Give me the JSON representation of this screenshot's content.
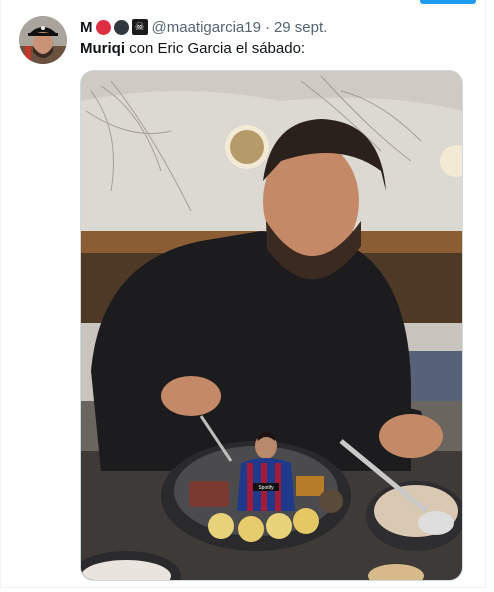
{
  "tweet": {
    "display_name": "M",
    "name_emojis": [
      "red-circle",
      "black-circle",
      "skull-and-crossbones"
    ],
    "skull_glyph": "☠",
    "handle": "@maatigarcia19",
    "separator": "·",
    "date": "29 sept.",
    "text_bold": "Muriqi",
    "text_rest": " con Eric Garcia el sábado:"
  },
  "media": {
    "jersey_sponsor": "Spotify"
  },
  "colors": {
    "accent": "#1d9bf0",
    "text_primary": "#0f1419",
    "text_secondary": "#536471",
    "border": "#cfd9de"
  }
}
